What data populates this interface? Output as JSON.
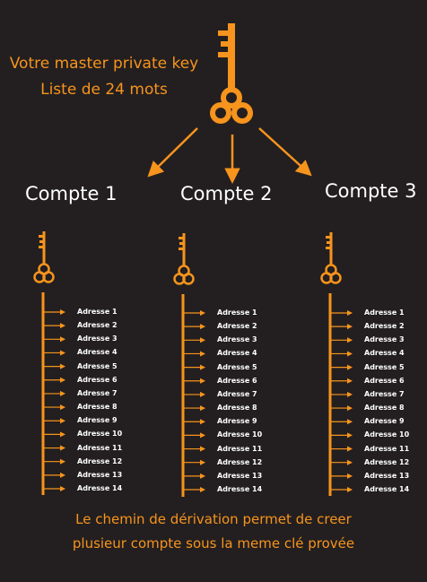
{
  "master": {
    "line1": "Votre master private key",
    "line2": "Liste de 24 mots"
  },
  "accounts": [
    {
      "label": "Compte 1",
      "addresses": [
        "Adresse 1",
        "Adresse 2",
        "Adresse 3",
        "Adresse 4",
        "Adresse 5",
        "Adresse 6",
        "Adresse 7",
        "Adresse 8",
        "Adresse 9",
        "Adresse 10",
        "Adresse 11",
        "Adresse 12",
        "Adresse 13",
        "Adresse 14"
      ]
    },
    {
      "label": "Compte 2",
      "addresses": [
        "Adresse 1",
        "Adresse 2",
        "Adresse 3",
        "Adresse 4",
        "Adresse 5",
        "Adresse 6",
        "Adresse 7",
        "Adresse 8",
        "Adresse 9",
        "Adresse 10",
        "Adresse 11",
        "Adresse 12",
        "Adresse 13",
        "Adresse 14"
      ]
    },
    {
      "label": "Compte 3",
      "addresses": [
        "Adresse 1",
        "Adresse 2",
        "Adresse 3",
        "Adresse 4",
        "Adresse 5",
        "Adresse 6",
        "Adresse 7",
        "Adresse 8",
        "Adresse 9",
        "Adresse 10",
        "Adresse 11",
        "Adresse 12",
        "Adresse 13",
        "Adresse 14"
      ]
    }
  ],
  "caption": {
    "line1": "Le chemin de dérivation permet de creer",
    "line2": "plusieur compte sous la meme clé provée"
  },
  "colors": {
    "background": "#231f20",
    "accent": "#f7941d",
    "text": "#ffffff"
  },
  "icons": {
    "master_key": "key-icon",
    "account_key": "key-icon"
  }
}
